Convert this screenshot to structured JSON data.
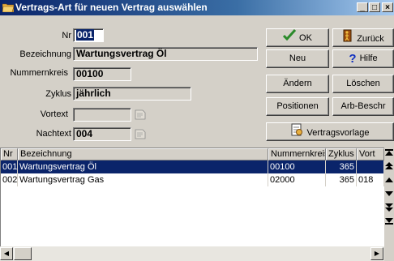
{
  "window": {
    "title": "Vertrags-Art für neuen Vertrag auswählen",
    "minimize": "_",
    "maximize": "□",
    "close": "×"
  },
  "form": {
    "nr_label": "Nr",
    "nr_value": "001",
    "bezeichnung_label": "Bezeichnung",
    "bezeichnung_value": "Wartungsvertrag Öl",
    "nummernkreis_label": "Nummernkreis",
    "nummernkreis_value": "00100",
    "zyklus_label": "Zyklus",
    "zyklus_value": "jährlich",
    "vortext_label": "Vortext",
    "vortext_value": "",
    "nachtext_label": "Nachtext",
    "nachtext_value": "004"
  },
  "buttons": {
    "ok": "OK",
    "zurueck": "Zurück",
    "neu": "Neu",
    "hilfe": "Hilfe",
    "aendern": "Ändern",
    "loeschen": "Löschen",
    "positionen": "Positionen",
    "arb_beschr": "Arb-Beschr",
    "vertragsvorlage": "Vertragsvorlage"
  },
  "table": {
    "columns": [
      "Nr",
      "Bezeichnung",
      "Nummernkreis",
      "Zyklus",
      "Vort"
    ],
    "rows": [
      {
        "nr": "001",
        "bezeichnung": "Wartungsvertrag Öl",
        "nummernkreis": "00100",
        "zyklus": "365",
        "vort": ""
      },
      {
        "nr": "002",
        "bezeichnung": "Wartungsvertrag Gas",
        "nummernkreis": "02000",
        "zyklus": "365",
        "vort": "018"
      }
    ],
    "selected_row": 0
  },
  "colors": {
    "selection": "#0a246a",
    "ok_check": "#2a8a2a",
    "help_q": "#1030c0"
  },
  "icons": {
    "app": "folder-icon",
    "ok": "checkmark-icon",
    "zurueck": "exit-door-icon",
    "hilfe": "question-icon",
    "vertragsvorlage": "document-icon",
    "lookup": "paper-icon"
  }
}
